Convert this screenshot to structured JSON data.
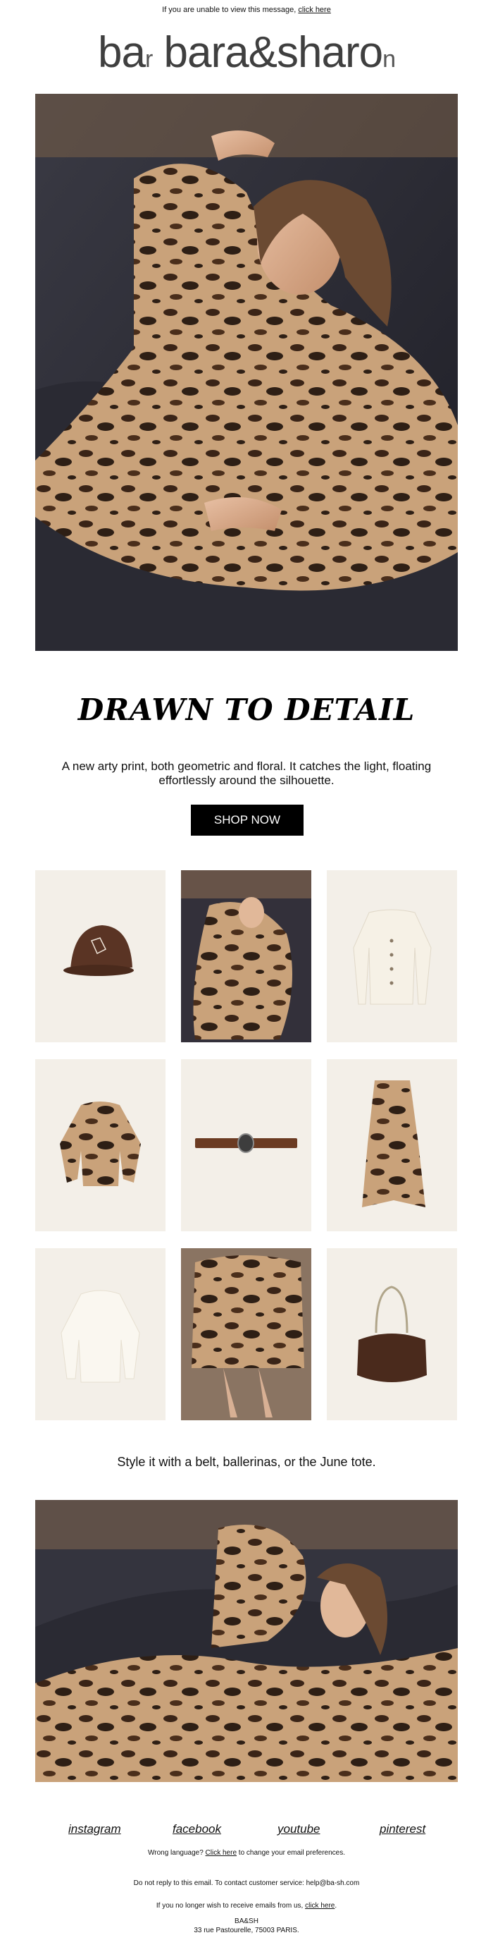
{
  "preheader": {
    "text": "If you are unable to view this message,",
    "link": "click here"
  },
  "brand": {
    "wordmark_full": "bara&sharo",
    "left_mark": "ba",
    "left_small": "r",
    "right_tail": "n"
  },
  "hero": {
    "image": "woman-in-leopard-print-dress-lying-on-sofa"
  },
  "headline": "DRAWN TO DETAIL",
  "subhead": "A new arty print, both geometric and floral. It catches the light, floating effortlessly around the silhouette.",
  "cta": "SHOP NOW",
  "products": [
    {
      "name": "brown-cap"
    },
    {
      "name": "model-in-print-dress"
    },
    {
      "name": "cream-cardigan"
    },
    {
      "name": "print-blouse"
    },
    {
      "name": "brown-belt"
    },
    {
      "name": "print-skirt"
    },
    {
      "name": "ivory-blouse"
    },
    {
      "name": "model-skirt-ballerinas"
    },
    {
      "name": "june-tote-bag"
    }
  ],
  "caption": "Style it with a belt, ballerinas, or the June tote.",
  "social": [
    "instagram",
    "facebook",
    "youtube",
    "pinterest"
  ],
  "footer": {
    "language_pre": "Wrong language?",
    "language_link": "Click here",
    "language_post": "to change your email preferences.",
    "noreply": "Do not reply to this email. To contact customer service: help@ba-sh.com",
    "unsubscribe_pre": "If you no longer wish to receive emails from us,",
    "unsubscribe_link": "click here",
    "company": "BA&SH",
    "address": "33 rue Pastourelle, 75003 PARIS."
  },
  "colors": {
    "tile_bg": "#f3efe8",
    "button_bg": "#000000",
    "print_tan": "#c9a27a",
    "print_dark": "#2e1f15"
  }
}
